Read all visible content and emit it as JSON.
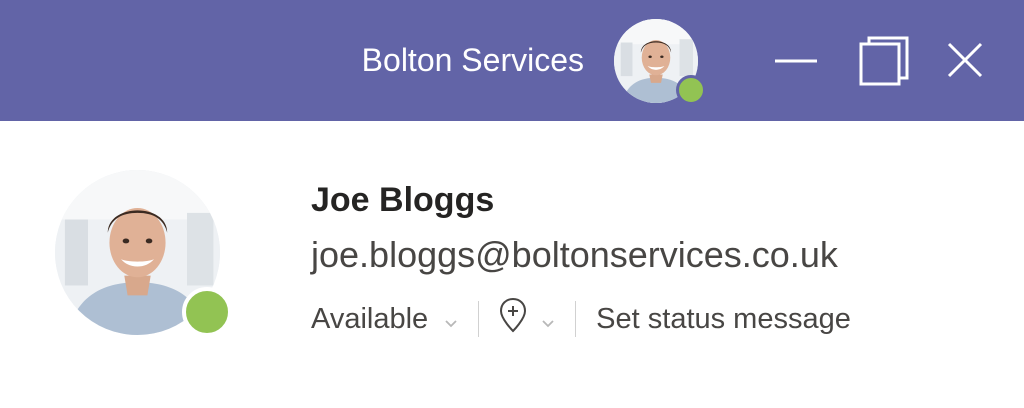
{
  "titlebar": {
    "org_name": "Bolton Services",
    "background_color": "#6264a7",
    "avatar_icon": "user-photo-avatar",
    "presence_color": "#92c353",
    "controls": {
      "minimize_icon": "minimize-icon",
      "maximize_icon": "restore-icon",
      "close_icon": "close-icon"
    }
  },
  "profile": {
    "name": "Joe Bloggs",
    "email": "joe.bloggs@boltonservices.co.uk",
    "avatar_icon": "user-photo-avatar",
    "presence_color": "#92c353",
    "status": {
      "label": "Available",
      "chevron_icon": "chevron-down-icon"
    },
    "location": {
      "icon": "location-pin-add-icon",
      "chevron_icon": "chevron-down-icon"
    },
    "status_message_label": "Set status message"
  }
}
